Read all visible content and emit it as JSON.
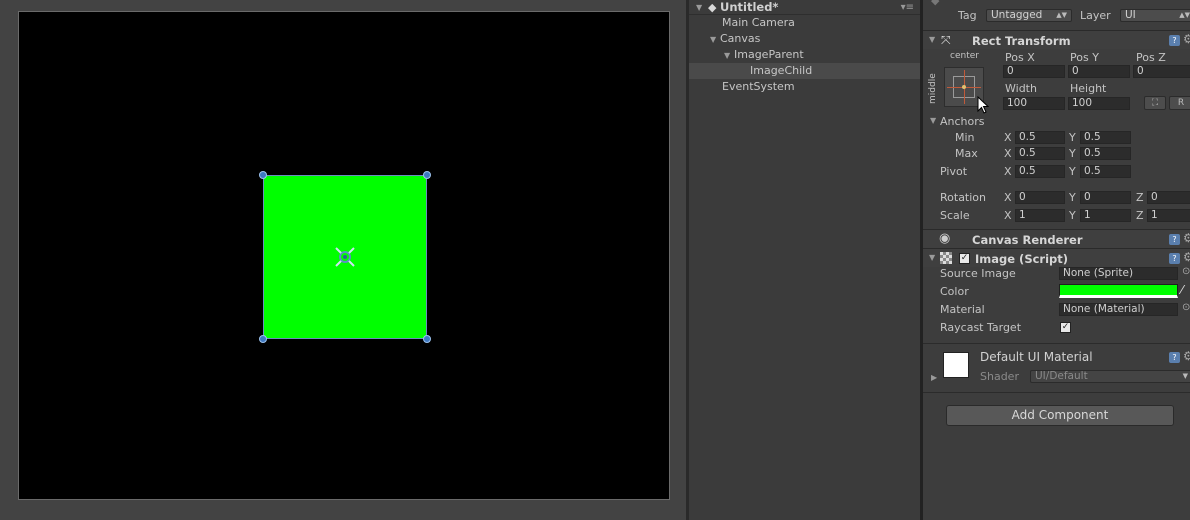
{
  "hierarchy": {
    "scene_title": "Untitled*",
    "items": [
      {
        "label": "Main Camera"
      },
      {
        "label": "Canvas"
      },
      {
        "label": "ImageParent"
      },
      {
        "label": "ImageChild"
      },
      {
        "label": "EventSystem"
      }
    ]
  },
  "scene": {
    "rect_color": "#00ff00"
  },
  "inspector": {
    "tag_label": "Tag",
    "tag_value": "Untagged",
    "layer_label": "Layer",
    "layer_value": "UI",
    "rect_transform": {
      "title": "Rect Transform",
      "preset_h": "center",
      "preset_v": "middle",
      "posx_label": "Pos X",
      "posy_label": "Pos Y",
      "posz_label": "Pos Z",
      "posx": "0",
      "posy": "0",
      "posz": "0",
      "width_label": "Width",
      "height_label": "Height",
      "width": "100",
      "height": "100",
      "r_button": "R",
      "anchors_label": "Anchors",
      "min_label": "Min",
      "max_label": "Max",
      "min_x": "0.5",
      "min_y": "0.5",
      "max_x": "0.5",
      "max_y": "0.5",
      "pivot_label": "Pivot",
      "pivot_x": "0.5",
      "pivot_y": "0.5",
      "rotation_label": "Rotation",
      "rot_x": "0",
      "rot_y": "0",
      "rot_z": "0",
      "scale_label": "Scale",
      "scale_x": "1",
      "scale_y": "1",
      "scale_z": "1",
      "x": "X",
      "y": "Y",
      "z": "Z"
    },
    "canvas_renderer": {
      "title": "Canvas Renderer"
    },
    "image": {
      "title": "Image (Script)",
      "source_image_label": "Source Image",
      "source_image": "None (Sprite)",
      "color_label": "Color",
      "color": "#00ff00",
      "material_label": "Material",
      "material": "None (Material)",
      "raycast_label": "Raycast Target",
      "raycast_checked": "✓"
    },
    "material_section": {
      "title": "Default UI Material",
      "shader_label": "Shader",
      "shader": "UI/Default"
    },
    "add_component": "Add Component"
  }
}
